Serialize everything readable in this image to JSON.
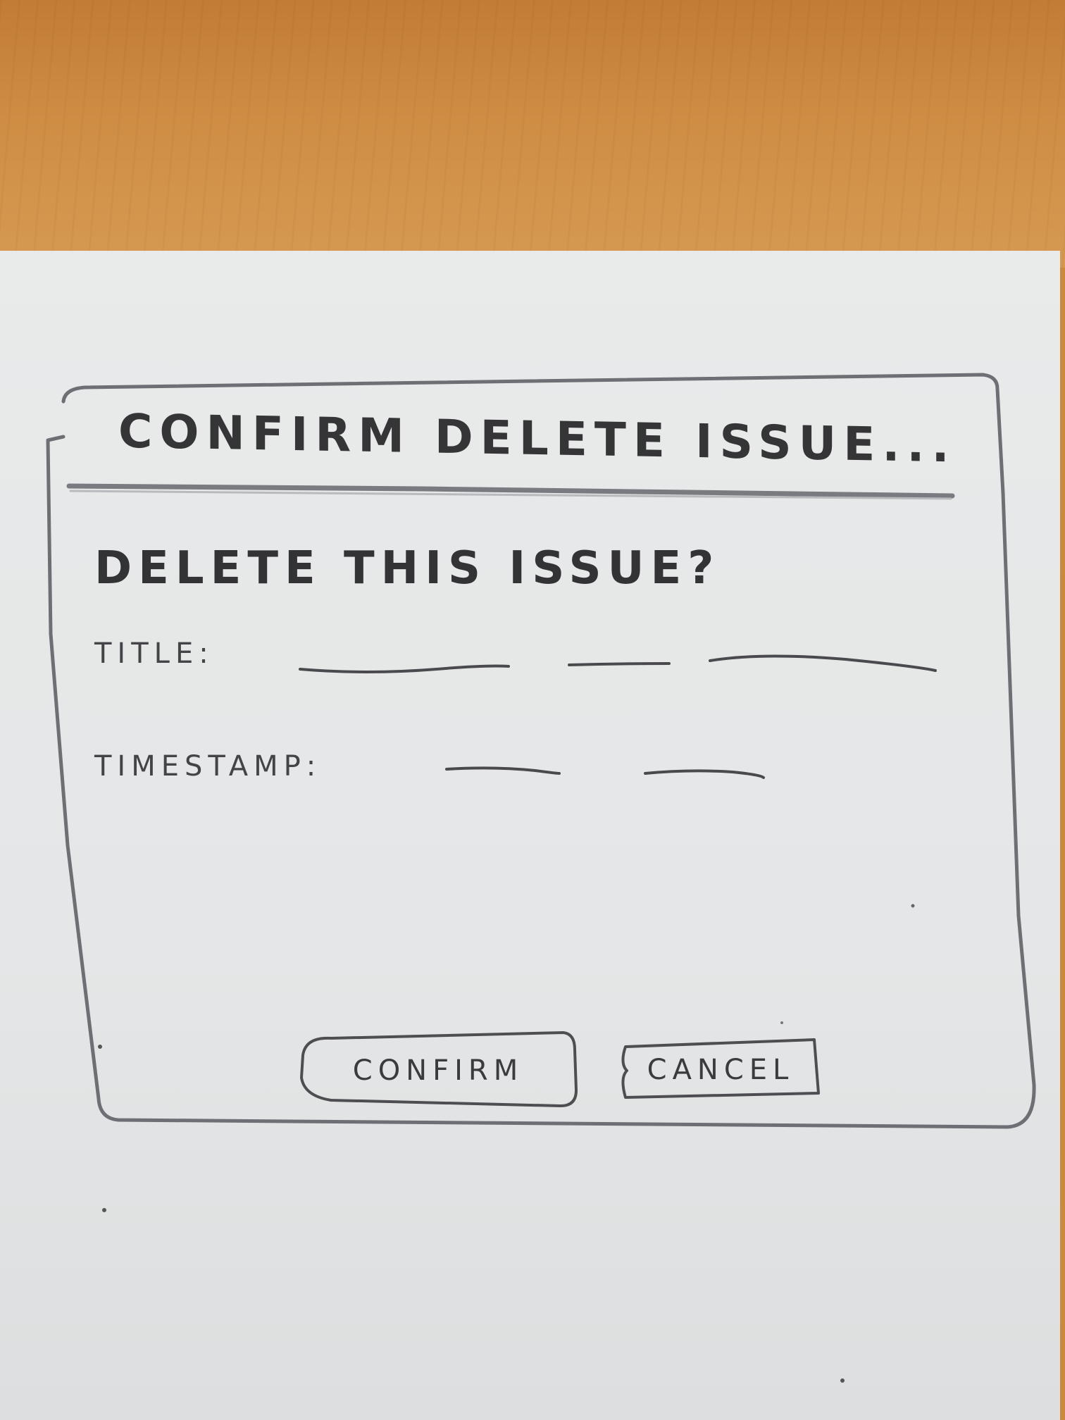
{
  "dialog": {
    "title": "CONFIRM DELETE ISSUE...",
    "question": "DELETE THIS ISSUE?",
    "fields": {
      "title_label": "TITLE:",
      "timestamp_label": "TIMESTAMP:"
    },
    "buttons": {
      "confirm_label": "CONFIRM",
      "cancel_label": "CANCEL"
    }
  },
  "colors": {
    "desk": "#c98a3e",
    "paper": "#e6e8e9",
    "ink": "#3a3a3e"
  }
}
